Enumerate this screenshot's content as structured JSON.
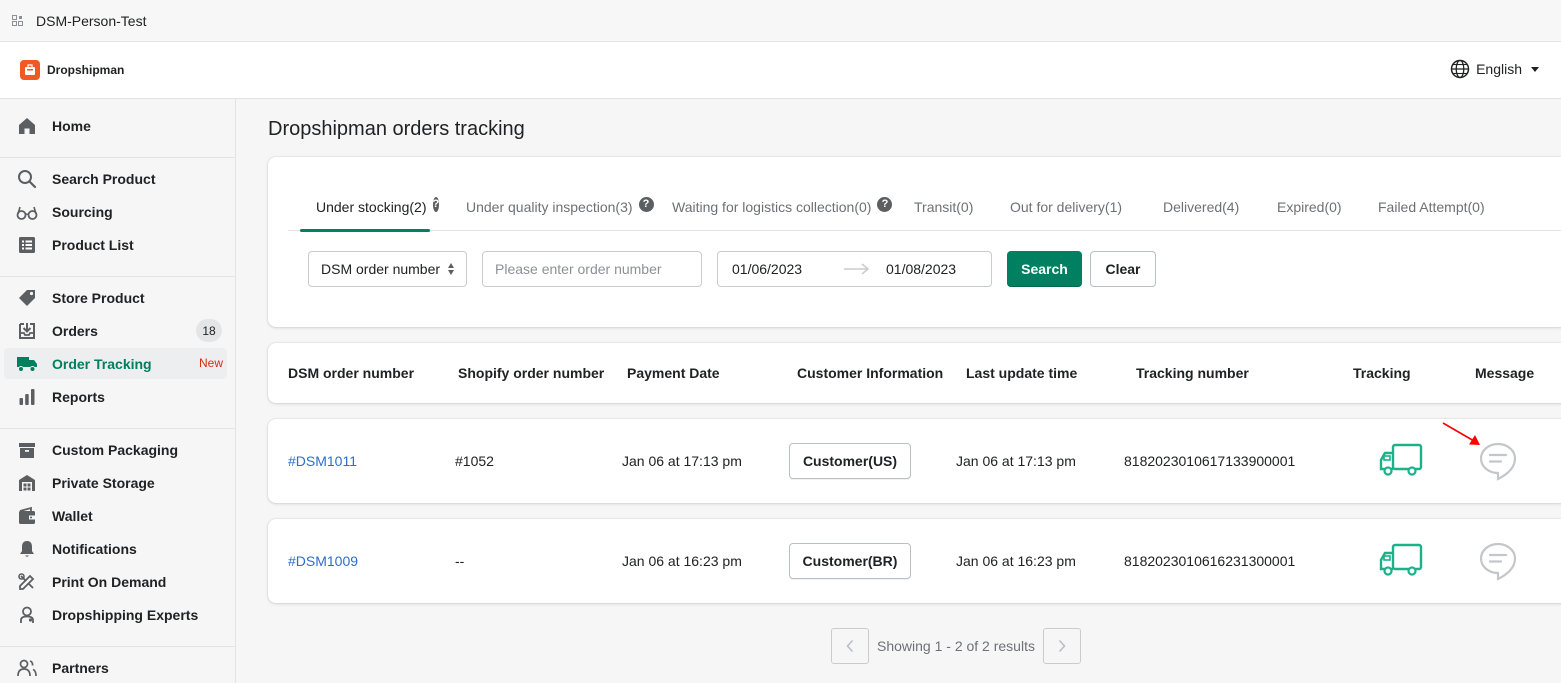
{
  "window": {
    "title": "DSM-Person-Test"
  },
  "header": {
    "brand": "Dropshipman",
    "language": "English"
  },
  "sidebar": {
    "items": [
      {
        "label": "Home"
      },
      {
        "label": "Search Product"
      },
      {
        "label": "Sourcing"
      },
      {
        "label": "Product List"
      },
      {
        "label": "Store Product"
      },
      {
        "label": "Orders",
        "badge": "18"
      },
      {
        "label": "Order Tracking",
        "tag": "New"
      },
      {
        "label": "Reports"
      },
      {
        "label": "Custom Packaging"
      },
      {
        "label": "Private Storage"
      },
      {
        "label": "Wallet"
      },
      {
        "label": "Notifications"
      },
      {
        "label": "Print On Demand"
      },
      {
        "label": "Dropshipping Experts"
      },
      {
        "label": "Partners"
      }
    ]
  },
  "main": {
    "title": "Dropshipman orders tracking",
    "tabs": [
      {
        "label": "Under stocking(2)"
      },
      {
        "label": "Under quality inspection(3)"
      },
      {
        "label": "Waiting for logistics collection(0)"
      },
      {
        "label": "Transit(0)"
      },
      {
        "label": "Out for delivery(1)"
      },
      {
        "label": "Delivered(4)"
      },
      {
        "label": "Expired(0)"
      },
      {
        "label": "Failed Attempt(0)"
      }
    ],
    "filters": {
      "select_value": "DSM order number",
      "order_placeholder": "Please enter order number",
      "date_start": "01/06/2023",
      "date_end": "01/08/2023",
      "search_label": "Search",
      "clear_label": "Clear"
    },
    "table": {
      "columns": [
        "DSM order number",
        "Shopify order number",
        "Payment Date",
        "Customer Information",
        "Last update time",
        "Tracking number",
        "Tracking",
        "Message"
      ],
      "rows": [
        {
          "dsm": "#DSM1011",
          "shopify": "#1052",
          "payment": "Jan 06 at 17:13 pm",
          "customer": "Customer(US)",
          "updated": "Jan 06 at 17:13 pm",
          "tracking": "8182023010617133900001"
        },
        {
          "dsm": "#DSM1009",
          "shopify": "--",
          "payment": "Jan 06 at 16:23 pm",
          "customer": "Customer(BR)",
          "updated": "Jan 06 at 16:23 pm",
          "tracking": "8182023010616231300001"
        }
      ]
    },
    "pagination": {
      "text": "Showing 1 - 2 of 2 results"
    }
  },
  "colors": {
    "accent": "#008060",
    "brand": "#f05a22",
    "link": "#2c6ecb",
    "new_tag": "#d72c0d",
    "truck": "#1bb28a",
    "annotation": "#ff0000"
  }
}
